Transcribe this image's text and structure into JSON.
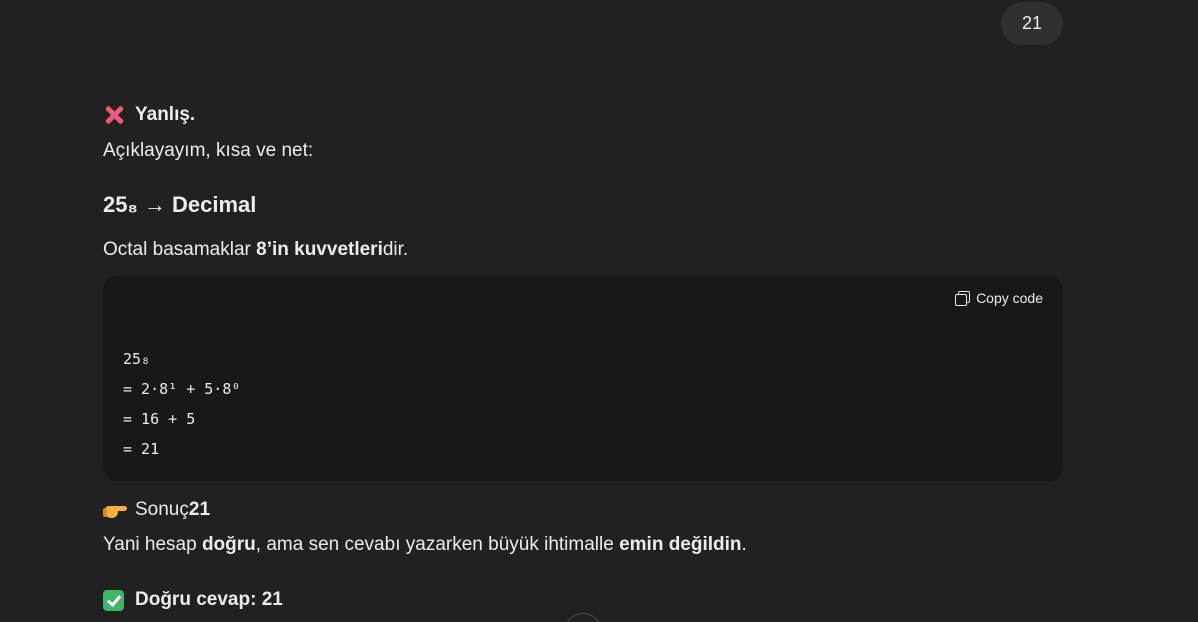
{
  "user_message": {
    "text": "21"
  },
  "answer": {
    "verdict": "Yanlış.",
    "intro": "Açıklayayım, kısa ve net:",
    "heading": "25₈ → Decimal",
    "octal_prefix": "Octal basamaklar ",
    "octal_bold": "8’in kuvvetleri",
    "octal_suffix": "dir.",
    "code": {
      "copy_label": "Copy code",
      "lines": [
        "25₈",
        "= 2·8¹ + 5·8⁰",
        "= 16 + 5",
        "= 21"
      ]
    },
    "result_prefix": "Sonuç ",
    "result_value": "21",
    "explain_prefix": "Yani hesap ",
    "explain_bold1": "doğru",
    "explain_mid": ", ama sen cevabı yazarken büyük ihtimalle ",
    "explain_bold2": "emin değildin",
    "explain_suffix": ".",
    "correct_label": "Doğru cevap: 21"
  },
  "icons": {
    "verdict": "cross-mark-icon",
    "result": "pointing-right-icon",
    "correct": "check-mark-icon",
    "copy": "copy-icon"
  },
  "colors": {
    "background": "#212121",
    "code_background": "#181818",
    "user_bubble": "#303030",
    "cross": "#f15a7f",
    "check": "#3fb56b"
  }
}
